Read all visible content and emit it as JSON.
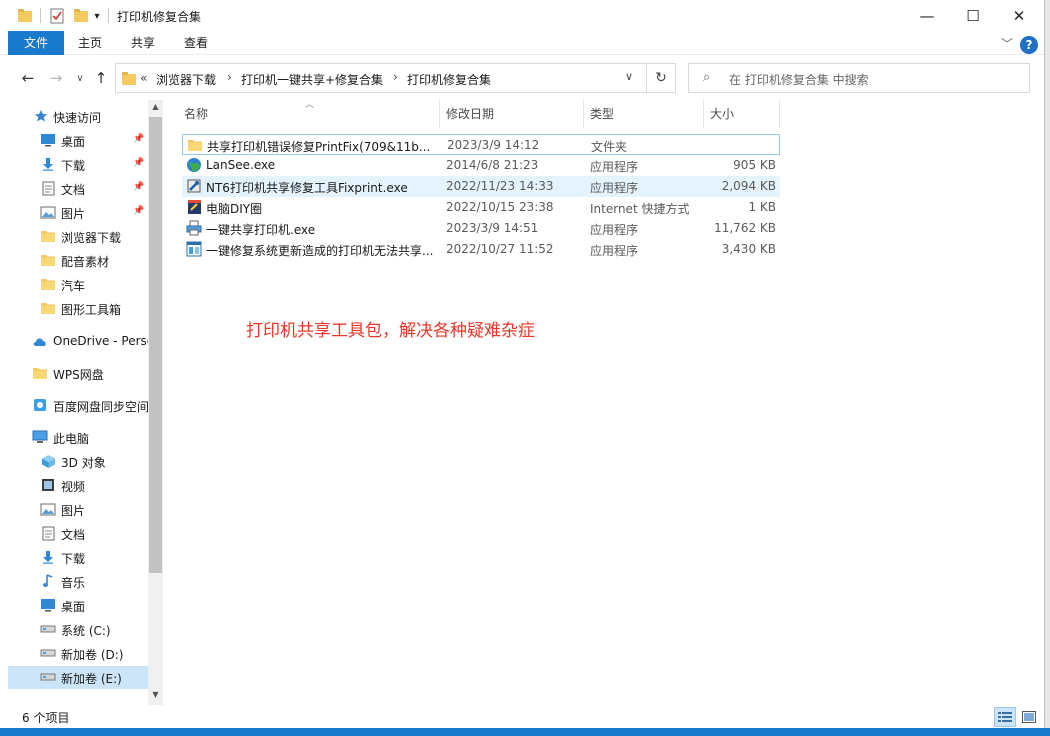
{
  "window": {
    "title": "打印机修复合集",
    "controls": {
      "minimize": "—",
      "maximize": "☐",
      "close": "✕"
    }
  },
  "ribbon": {
    "tabs": [
      "文件",
      "主页",
      "共享",
      "查看"
    ],
    "help": "?"
  },
  "address": {
    "overflow": "«",
    "crumbs": [
      "浏览器下载",
      "打印机一键共享+修复合集",
      "打印机修复合集"
    ],
    "separator": "›"
  },
  "search": {
    "placeholder": "在 打印机修复合集 中搜索"
  },
  "sidebar": {
    "items": [
      {
        "label": "快速访问",
        "icon": "star-icon"
      },
      {
        "label": "桌面",
        "icon": "desktop-icon",
        "pinned": true
      },
      {
        "label": "下载",
        "icon": "download-icon",
        "pinned": true
      },
      {
        "label": "文档",
        "icon": "document-icon",
        "pinned": true
      },
      {
        "label": "图片",
        "icon": "picture-icon",
        "pinned": true
      },
      {
        "label": "浏览器下载",
        "icon": "folder-icon"
      },
      {
        "label": "配音素材",
        "icon": "folder-icon"
      },
      {
        "label": "汽车",
        "icon": "folder-icon"
      },
      {
        "label": "图形工具箱",
        "icon": "folder-icon"
      },
      {
        "label": "OneDrive - Perso",
        "icon": "cloud-icon"
      },
      {
        "label": "WPS网盘",
        "icon": "folder-icon"
      },
      {
        "label": "百度网盘同步空间",
        "icon": "sync-icon"
      },
      {
        "label": "此电脑",
        "icon": "computer-icon"
      },
      {
        "label": "3D 对象",
        "icon": "cube-icon"
      },
      {
        "label": "视频",
        "icon": "video-icon"
      },
      {
        "label": "图片",
        "icon": "picture-icon"
      },
      {
        "label": "文档",
        "icon": "document-icon"
      },
      {
        "label": "下载",
        "icon": "download-icon"
      },
      {
        "label": "音乐",
        "icon": "music-icon"
      },
      {
        "label": "桌面",
        "icon": "desktop-icon"
      },
      {
        "label": "系统 (C:)",
        "icon": "drive-icon"
      },
      {
        "label": "新加卷 (D:)",
        "icon": "drive-icon"
      },
      {
        "label": "新加卷 (E:)",
        "icon": "drive-icon",
        "selected": true
      }
    ]
  },
  "columns": {
    "name": "名称",
    "date": "修改日期",
    "type": "类型",
    "size": "大小"
  },
  "files": [
    {
      "name": "共享打印机错误修复PrintFix(709&11b...",
      "date": "2023/3/9 14:12",
      "type": "文件夹",
      "size": "",
      "icon": "folder-icon"
    },
    {
      "name": "LanSee.exe",
      "date": "2014/6/8 21:23",
      "type": "应用程序",
      "size": "905 KB",
      "icon": "globe-icon"
    },
    {
      "name": "NT6打印机共享修复工具Fixprint.exe",
      "date": "2022/11/23 14:33",
      "type": "应用程序",
      "size": "2,094 KB",
      "icon": "tool-icon"
    },
    {
      "name": "电脑DIY圈",
      "date": "2022/10/15 23:38",
      "type": "Internet 快捷方式",
      "size": "1 KB",
      "icon": "shortcut-icon"
    },
    {
      "name": "一键共享打印机.exe",
      "date": "2023/3/9 14:51",
      "type": "应用程序",
      "size": "11,762 KB",
      "icon": "printer-icon"
    },
    {
      "name": "一键修复系统更新造成的打印机无法共享...",
      "date": "2022/10/27 11:52",
      "type": "应用程序",
      "size": "3,430 KB",
      "icon": "app-icon"
    }
  ],
  "annotation": "打印机共享工具包，解决各种疑难杂症",
  "status": {
    "count": "6 个项目"
  },
  "colors": {
    "accent": "#1979ca",
    "annotation": "#e8372a",
    "selection": "#cce4f7"
  }
}
